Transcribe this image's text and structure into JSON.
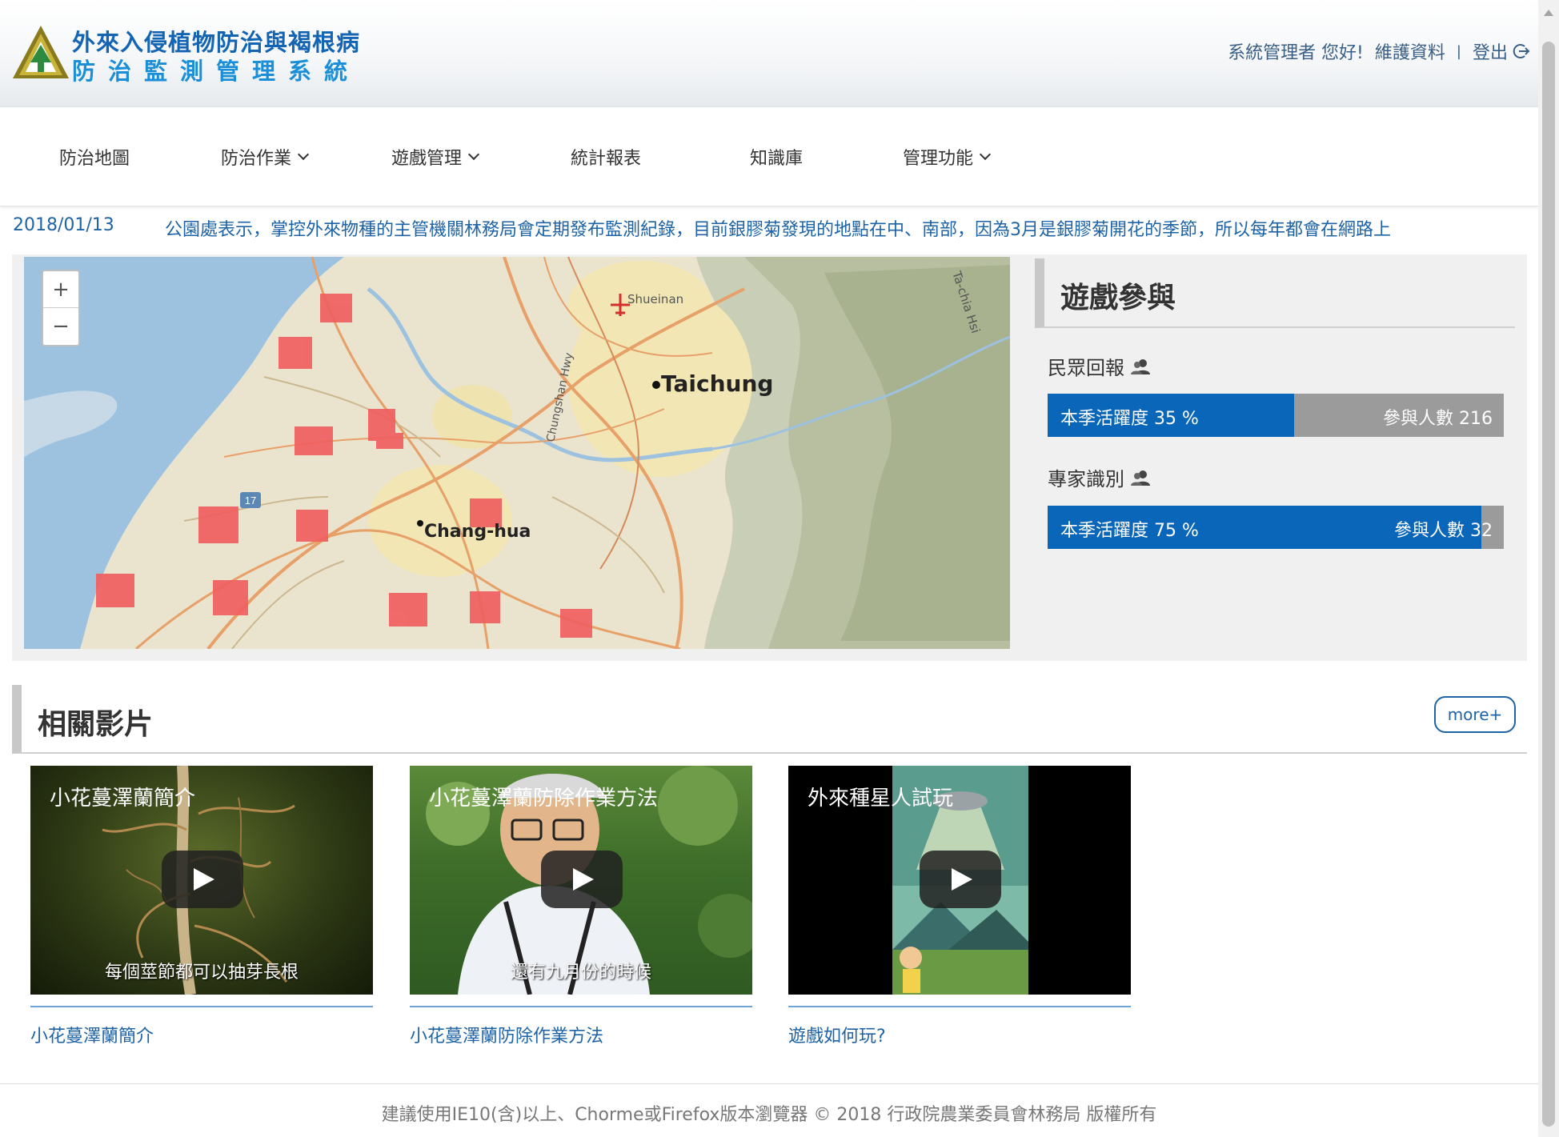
{
  "header": {
    "brand_line1": "外來入侵植物防治與褐根病",
    "brand_line2": "防治監測管理系統",
    "greeting": "系統管理者 您好!",
    "profile_link": "維護資料",
    "separator": "|",
    "logout_label": "登出"
  },
  "nav": {
    "items": [
      {
        "label": "防治地圖",
        "dropdown": false
      },
      {
        "label": "防治作業",
        "dropdown": true
      },
      {
        "label": "遊戲管理",
        "dropdown": true
      },
      {
        "label": "統計報表",
        "dropdown": false
      },
      {
        "label": "知識庫",
        "dropdown": false
      },
      {
        "label": "管理功能",
        "dropdown": true
      }
    ]
  },
  "news": {
    "date": "2018/01/13",
    "text": "公園處表示，掌控外來物種的主管機關林務局會定期發布監測紀錄，目前銀膠菊發現的地點在中、南部，因為3月是銀膠菊開花的季節，所以每年都會在網路上"
  },
  "map": {
    "zoom_in": "+",
    "zoom_out": "−",
    "labels": {
      "shueinan": "Shueinan",
      "taichung": "Taichung",
      "changhua": "Chang-hua",
      "highway": "Chungshan Hwy",
      "river": "Ta-chia Hsi",
      "route": "17"
    }
  },
  "game": {
    "title": "遊戲參與",
    "stats": [
      {
        "label": "民眾回報",
        "activity": "本季活躍度 35 %",
        "participants": "參與人數 216",
        "percent": 35
      },
      {
        "label": "專家識別",
        "activity": "本季活躍度 75 %",
        "participants": "參與人數 32",
        "percent": 95
      }
    ]
  },
  "videos": {
    "title": "相關影片",
    "more": "more+",
    "items": [
      {
        "title": "小花蔓澤蘭簡介",
        "subtitle": "每個莖節都可以抽芽長根",
        "caption": "小花蔓澤蘭簡介"
      },
      {
        "title": "小花蔓澤蘭防除作業方法",
        "subtitle": "還有九月份的時候",
        "caption": "小花蔓澤蘭防除作業方法"
      },
      {
        "title": "外來種星人試玩",
        "subtitle": "",
        "caption": "遊戲如何玩?"
      }
    ]
  },
  "footer": {
    "text": "建議使用IE10(含)以上、Chorme或Firefox版本瀏覽器 © 2018 行政院農業委員會林務局 版權所有"
  },
  "colors": {
    "primary": "#0a66b8",
    "link": "#1e63a6",
    "bar_bg": "#9b9b9b",
    "heat": "#ef5f5f"
  }
}
